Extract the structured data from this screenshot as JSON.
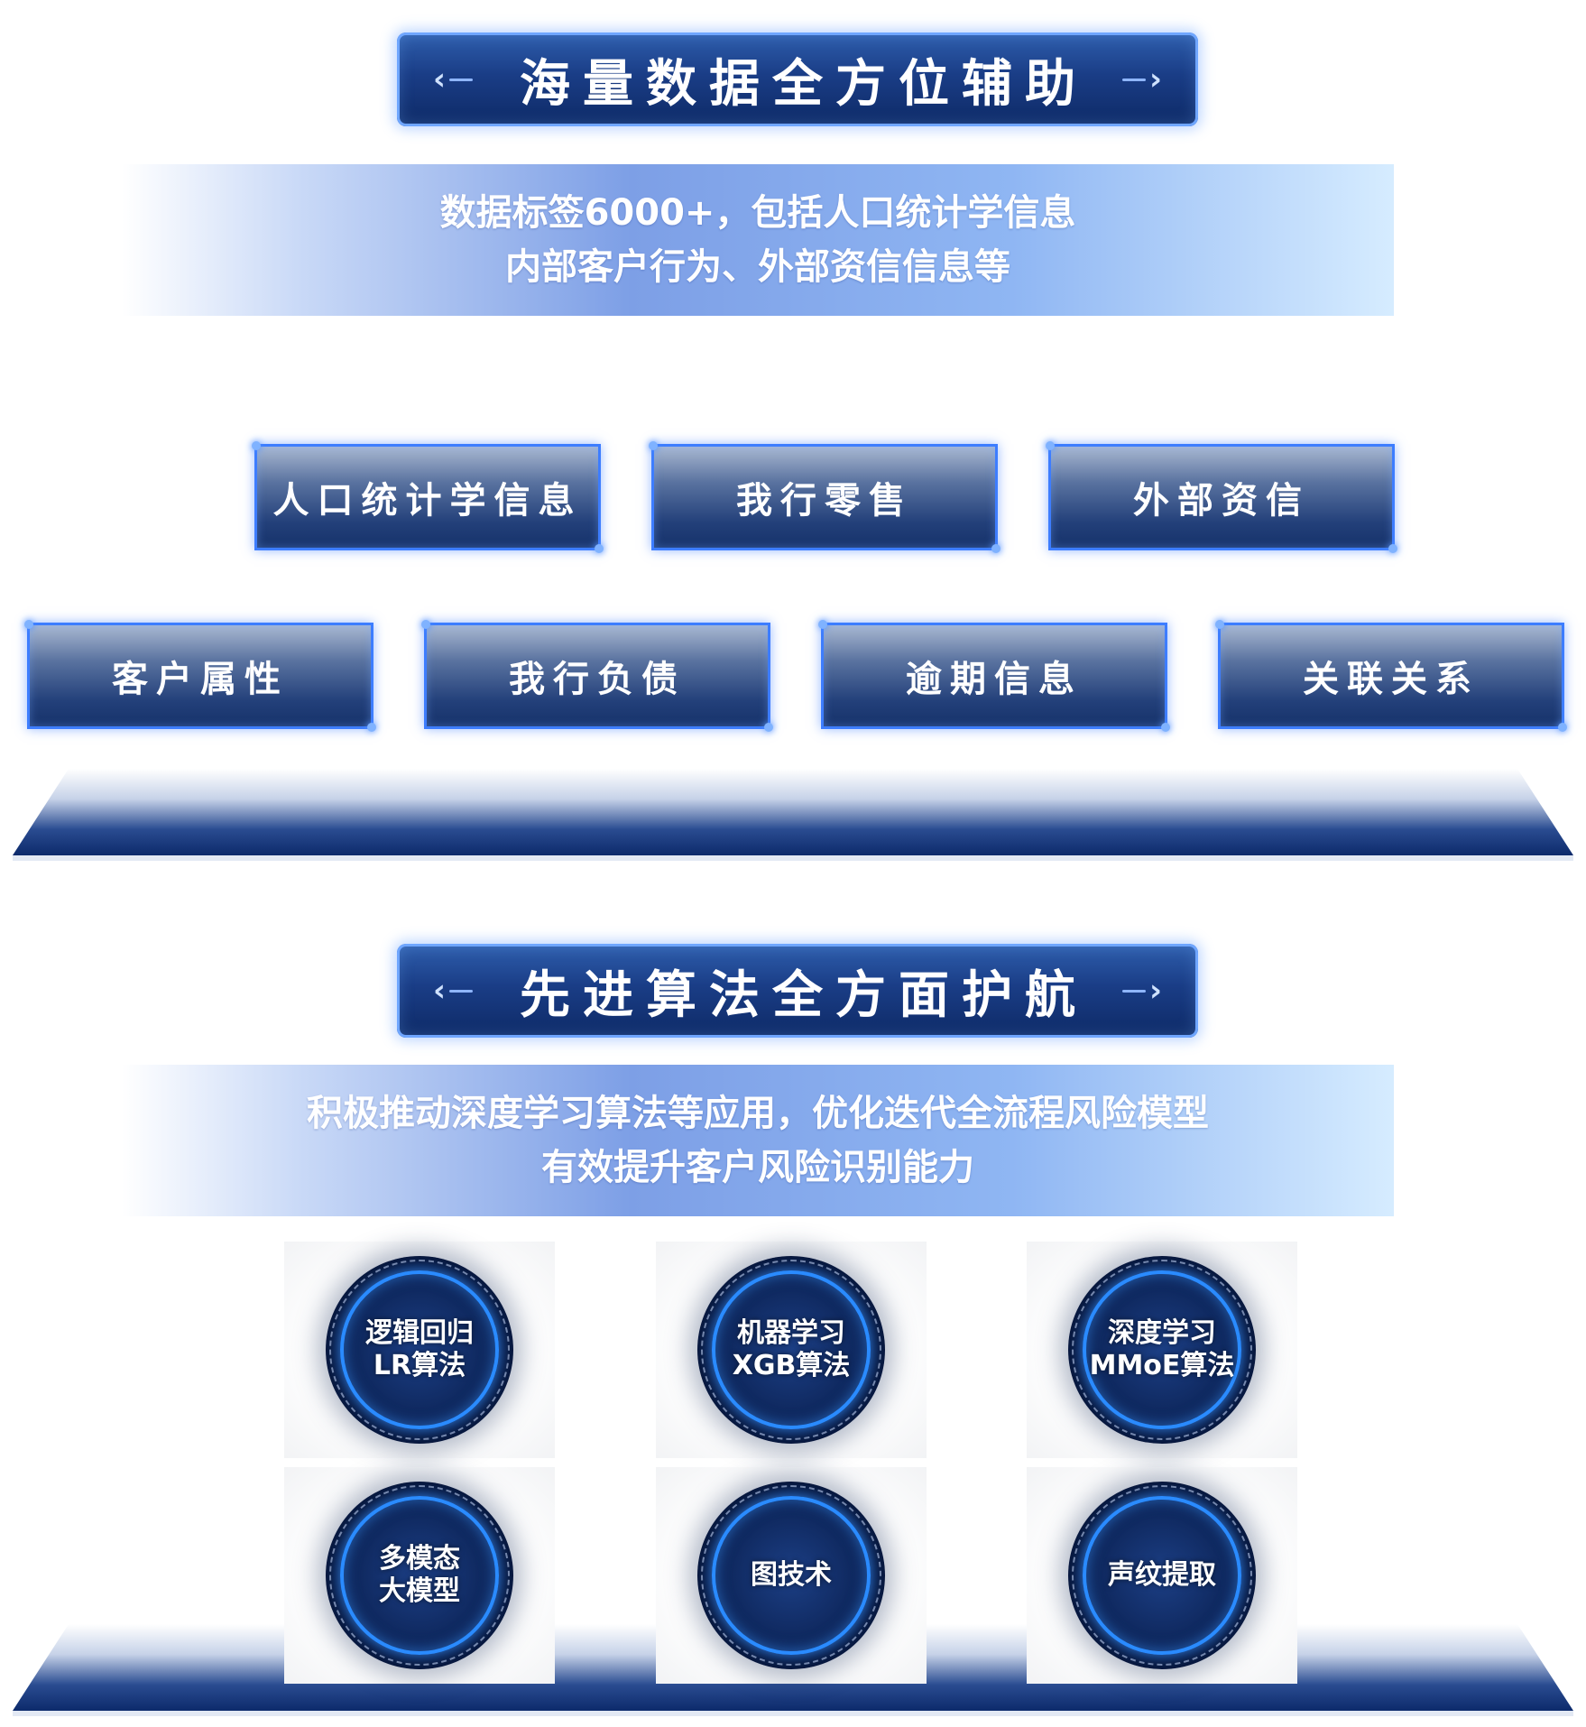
{
  "section1": {
    "title": "海量数据全方位辅助",
    "desc_line1": "数据标签6000+，包括人口统计学信息",
    "desc_line2": "内部客户行为、外部资信信息等",
    "tags_row1": [
      "人口统计学信息",
      "我行零售",
      "外部资信"
    ],
    "tags_row2": [
      "客户属性",
      "我行负债",
      "逾期信息",
      "关联关系"
    ]
  },
  "section2": {
    "title": "先进算法全方面护航",
    "desc_line1": "积极推动深度学习算法等应用，优化迭代全流程风险模型",
    "desc_line2": "有效提升客户风险识别能力",
    "algorithms": [
      {
        "line1": "逻辑回归",
        "line2": "LR算法"
      },
      {
        "line1": "机器学习",
        "line2": "XGB算法"
      },
      {
        "line1": "深度学习",
        "line2": "MMoE算法"
      },
      {
        "line1": "多模态",
        "line2": "大模型"
      },
      {
        "line1": "图技术",
        "line2": ""
      },
      {
        "line1": "声纹提取",
        "line2": ""
      }
    ]
  },
  "colors": {
    "banner_dark": "#0e2a66",
    "banner_mid": "#1a3d86",
    "glow_blue": "#3d7dff",
    "ring_blue": "#2a8bff"
  },
  "icons": {
    "left_chevron": "‹",
    "right_chevron": "›"
  }
}
